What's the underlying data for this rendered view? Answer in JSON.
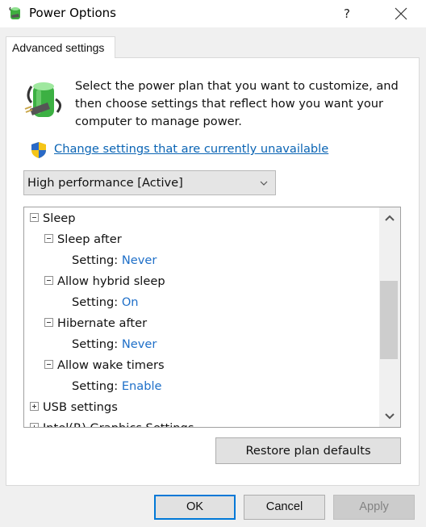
{
  "window": {
    "title": "Power Options",
    "help_label": "?",
    "icons": {
      "app": "power-options-icon",
      "help": "help-icon",
      "close": "close-icon"
    }
  },
  "tabs": [
    {
      "label": "Advanced settings",
      "active": true
    }
  ],
  "intro": {
    "icon": "battery-plug-icon",
    "description": "Select the power plan that you want to customize, and then choose settings that reflect how you want your computer to manage power.",
    "link_icon": "uac-shield-icon",
    "link_text": "Change settings that are currently unavailable"
  },
  "plan_select": {
    "value": "High performance [Active]",
    "icon": "chevron-down-icon"
  },
  "tree": {
    "rows": [
      {
        "label": "Sleep",
        "level": 0,
        "toggle": "minus"
      },
      {
        "label": "Sleep after",
        "level": 1,
        "toggle": "minus"
      },
      {
        "label": "Setting:",
        "value": "Never",
        "level": 2
      },
      {
        "label": "Allow hybrid sleep",
        "level": 1,
        "toggle": "minus"
      },
      {
        "label": "Setting:",
        "value": "On",
        "level": 2
      },
      {
        "label": "Hibernate after",
        "level": 1,
        "toggle": "minus"
      },
      {
        "label": "Setting:",
        "value": "Never",
        "level": 2
      },
      {
        "label": "Allow wake timers",
        "level": 1,
        "toggle": "minus"
      },
      {
        "label": "Setting:",
        "value": "Enable",
        "level": 2
      },
      {
        "label": "USB settings",
        "level": 0,
        "toggle": "plus"
      },
      {
        "label": "Intel(R) Graphics Settings",
        "level": 0,
        "toggle": "plus"
      }
    ],
    "value_color": "#1e6fc8",
    "scrollbar": {
      "up_icon": "chevron-up-icon",
      "down_icon": "chevron-down-icon"
    }
  },
  "buttons": {
    "restore": "Restore plan defaults",
    "ok": "OK",
    "cancel": "Cancel",
    "apply": "Apply"
  },
  "colors": {
    "link": "#0a64b4",
    "focus_border": "#0078d7"
  }
}
